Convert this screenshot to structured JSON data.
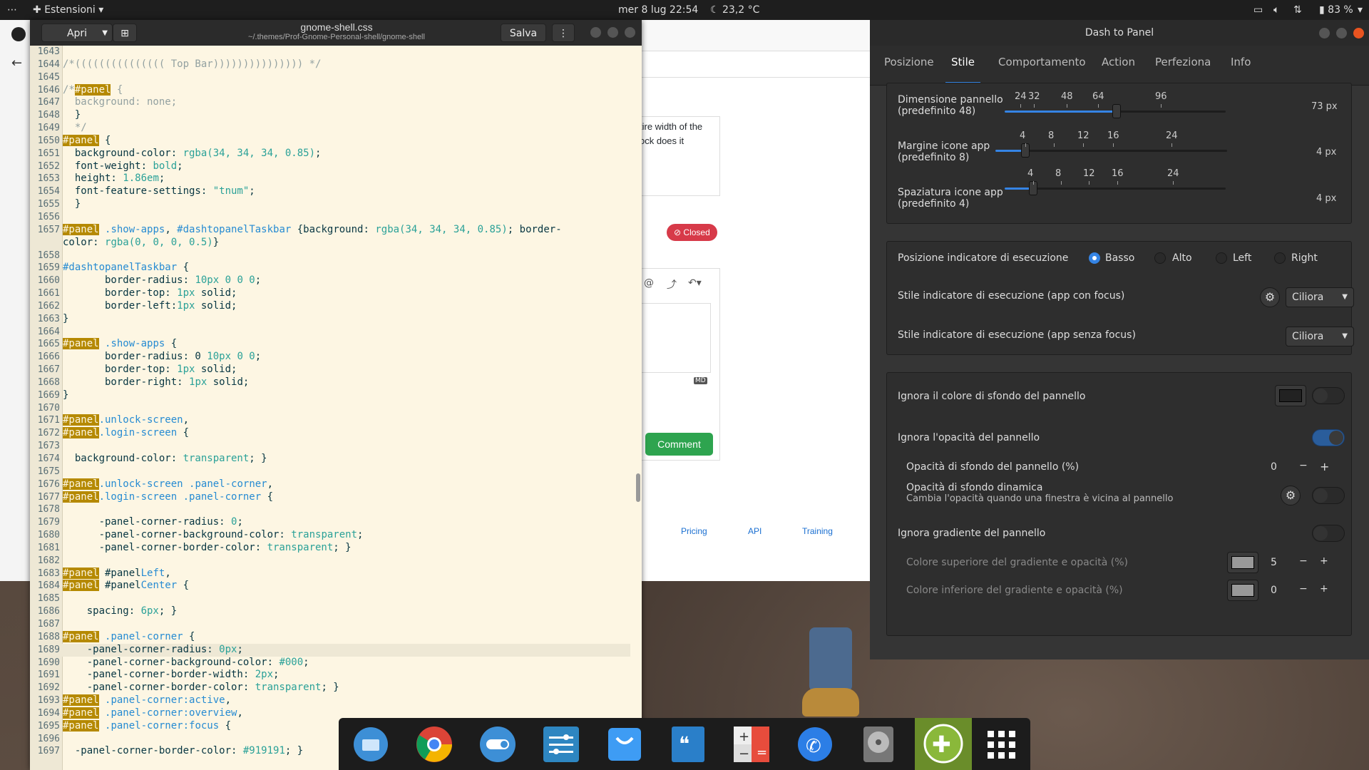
{
  "topbar": {
    "activities": "⋯",
    "app_menu": "Estensioni",
    "clock": "mer 8 lug  22:54",
    "weather": "23,2 °C",
    "battery": "83 %"
  },
  "browser": {
    "snippet_line1": "tire width of the",
    "snippet_line2": "ock does it",
    "status_badge": "Closed",
    "comment_button": "Comment",
    "md_badge": "MD",
    "footer_links": [
      "Pricing",
      "API",
      "Training"
    ]
  },
  "editor": {
    "open_button": "Apri",
    "save_button": "Salva",
    "filename": "gnome-shell.css",
    "path": "~/.themes/Prof-Gnome-Personal-shell/gnome-shell",
    "lines": [
      {
        "n": "1643",
        "t": ""
      },
      {
        "n": "1644",
        "t": "/*((((((((((((((( Top Bar))))))))))))))) */"
      },
      {
        "n": "1645",
        "t": ""
      },
      {
        "n": "1646",
        "t": "/*#panel {"
      },
      {
        "n": "1647",
        "t": "  background: none;"
      },
      {
        "n": "1648",
        "t": "  }"
      },
      {
        "n": "1649",
        "t": "  */"
      },
      {
        "n": "1650",
        "t": "#panel {"
      },
      {
        "n": "1651",
        "t": "  background-color: rgba(34, 34, 34, 0.85);"
      },
      {
        "n": "1652",
        "t": "  font-weight: bold;"
      },
      {
        "n": "1653",
        "t": "  height: 1.86em;"
      },
      {
        "n": "1654",
        "t": "  font-feature-settings: \"tnum\";"
      },
      {
        "n": "1655",
        "t": "  }"
      },
      {
        "n": "1656",
        "t": ""
      },
      {
        "n": "1657",
        "t": "#panel .show-apps, #dashtopanelTaskbar {background: rgba(34, 34, 34, 0.85); border-"
      },
      {
        "n": "",
        "t": "color: rgba(0, 0, 0, 0.5)}"
      },
      {
        "n": "1658",
        "t": ""
      },
      {
        "n": "1659",
        "t": "#dashtopanelTaskbar {"
      },
      {
        "n": "1660",
        "t": "       border-radius: 10px 0 0 0;"
      },
      {
        "n": "1661",
        "t": "       border-top: 1px solid;"
      },
      {
        "n": "1662",
        "t": "       border-left:1px solid;"
      },
      {
        "n": "1663",
        "t": "}"
      },
      {
        "n": "1664",
        "t": ""
      },
      {
        "n": "1665",
        "t": "#panel .show-apps {"
      },
      {
        "n": "1666",
        "t": "       border-radius: 0 10px 0 0;"
      },
      {
        "n": "1667",
        "t": "       border-top: 1px solid;"
      },
      {
        "n": "1668",
        "t": "       border-right: 1px solid;"
      },
      {
        "n": "1669",
        "t": "}"
      },
      {
        "n": "1670",
        "t": ""
      },
      {
        "n": "1671",
        "t": "#panel.unlock-screen,"
      },
      {
        "n": "1672",
        "t": "#panel.login-screen {"
      },
      {
        "n": "1673",
        "t": ""
      },
      {
        "n": "1674",
        "t": "  background-color: transparent; }"
      },
      {
        "n": "1675",
        "t": ""
      },
      {
        "n": "1676",
        "t": "#panel.unlock-screen .panel-corner,"
      },
      {
        "n": "1677",
        "t": "#panel.login-screen .panel-corner {"
      },
      {
        "n": "1678",
        "t": ""
      },
      {
        "n": "1679",
        "t": "      -panel-corner-radius: 0;"
      },
      {
        "n": "1680",
        "t": "      -panel-corner-background-color: transparent;"
      },
      {
        "n": "1681",
        "t": "      -panel-corner-border-color: transparent; }"
      },
      {
        "n": "1682",
        "t": ""
      },
      {
        "n": "1683",
        "t": "#panel #panelLeft,"
      },
      {
        "n": "1684",
        "t": "#panel #panelCenter {"
      },
      {
        "n": "1685",
        "t": ""
      },
      {
        "n": "1686",
        "t": "    spacing: 6px; }"
      },
      {
        "n": "1687",
        "t": ""
      },
      {
        "n": "1688",
        "t": "#panel .panel-corner {"
      },
      {
        "n": "1689",
        "t": "    -panel-corner-radius: 0px;"
      },
      {
        "n": "1690",
        "t": "    -panel-corner-background-color: #000;"
      },
      {
        "n": "1691",
        "t": "    -panel-corner-border-width: 2px;"
      },
      {
        "n": "1692",
        "t": "    -panel-corner-border-color: transparent; }"
      },
      {
        "n": "1693",
        "t": "#panel .panel-corner:active,"
      },
      {
        "n": "1694",
        "t": "#panel .panel-corner:overview,"
      },
      {
        "n": "1695",
        "t": "#panel .panel-corner:focus {"
      },
      {
        "n": "1696",
        "t": ""
      },
      {
        "n": "1697",
        "t": "  -panel-corner-border-color: #919191; }"
      }
    ],
    "current_line": "1689"
  },
  "dtp": {
    "title": "Dash to Panel",
    "tabs": [
      "Posizione",
      "Stile",
      "Comportamento",
      "Action",
      "Perfeziona",
      "Info"
    ],
    "active_tab": "Stile",
    "sliders": [
      {
        "label1": "Dimensione pannello",
        "label2": "(predefinito 48)",
        "marks": [
          "24",
          "32",
          "48",
          "64",
          "96"
        ],
        "value": "73 px"
      },
      {
        "label1": "Margine icone app",
        "label2": "(predefinito 8)",
        "marks": [
          "4",
          "8",
          "12",
          "16",
          "24"
        ],
        "value": "4 px"
      },
      {
        "label1": "Spaziatura icone app",
        "label2": "(predefinito 4)",
        "marks": [
          "4",
          "8",
          "12",
          "16",
          "24"
        ],
        "value": "4 px"
      }
    ],
    "indicator_position_label": "Posizione indicatore di esecuzione",
    "indicator_options": [
      "Basso",
      "Alto",
      "Left",
      "Right"
    ],
    "indicator_selected": "Basso",
    "focus_style_label": "Stile indicatore di esecuzione (app con focus)",
    "focus_style_value": "Ciliora",
    "nofocus_style_label": "Stile indicatore di esecuzione (app senza focus)",
    "nofocus_style_value": "Ciliora",
    "ignore_bg_color": "Ignora il colore di sfondo del pannello",
    "ignore_opacity": "Ignora l'opacità del pannello",
    "bg_opacity_label": "Opacità di sfondo del pannello (%)",
    "bg_opacity_value": "0",
    "dynamic_opacity_label": "Opacità di sfondo dinamica",
    "dynamic_opacity_sub": "Cambia l'opacità quando una finestra è vicina al pannello",
    "ignore_gradient": "Ignora gradiente del pannello",
    "gradient_top_label": "Colore superiore del gradiente e opacità (%)",
    "gradient_top_value": "5",
    "gradient_bottom_label": "Colore inferiore del gradiente e opacità (%)",
    "gradient_bottom_value": "0",
    "minus": "−",
    "plus": "+",
    "colors": {
      "accent": "#3584e4",
      "close": "#e95420"
    }
  },
  "dock": {
    "apps": [
      "files-icon",
      "chrome-icon",
      "toggle-icon",
      "settings-sliders-icon",
      "tasks-icon",
      "quotes-icon",
      "calculator-icon",
      "phone-icon",
      "disk-icon",
      "extensions-icon",
      "app-grid-icon"
    ],
    "active_app": "extensions-icon"
  }
}
